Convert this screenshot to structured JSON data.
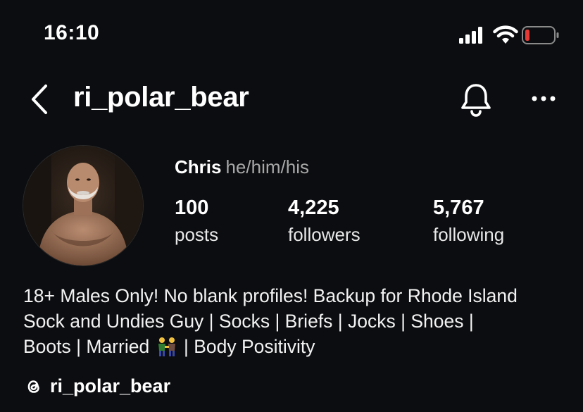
{
  "status_bar": {
    "time": "16:10",
    "battery_color": "#e53935"
  },
  "header": {
    "username": "ri_polar_bear",
    "back_icon": "chevron-left-icon",
    "bell_icon": "bell-icon",
    "more_icon": "more-horizontal-icon"
  },
  "profile": {
    "name": "Chris",
    "pronouns": "he/him/his",
    "stats": [
      {
        "value": "100",
        "label": "posts"
      },
      {
        "value": "4,225",
        "label": "followers"
      },
      {
        "value": "5,767",
        "label": "following"
      }
    ],
    "bio_lines": [
      "18+ Males Only! No blank profiles! Backup for Rhode Island",
      "Sock and Undies Guy | Socks | Briefs | Jocks | Shoes |",
      "Boots | Married",
      " | Body Positivity"
    ],
    "bio_emoji": "men-holding-hands-emoji",
    "threads_handle": "ri_polar_bear"
  }
}
